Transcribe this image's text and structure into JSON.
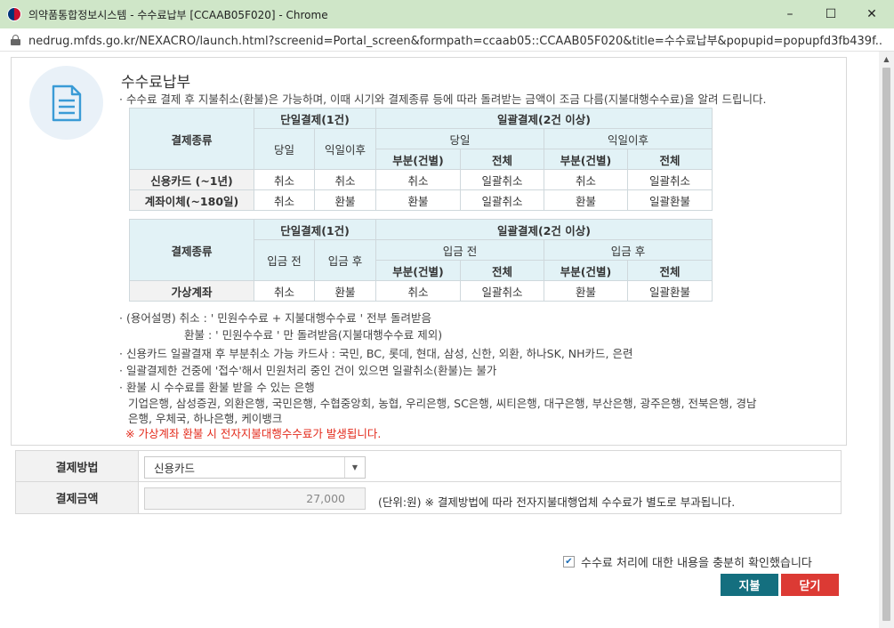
{
  "window": {
    "title": "의약품통합정보시스템 - 수수료납부 [CCAAB05F020] - Chrome",
    "url": "nedrug.mfds.go.kr/NEXACRO/launch.html?screenid=Portal_screen&formpath=ccaab05::CCAAB05F020&title=수수료납부&popupid=popupfd3fb439f..."
  },
  "header": {
    "title": "수수료납부",
    "desc": "· 수수료 결제 후 지불취소(환불)은 가능하며, 이때 시기와 결제종류 등에 따라 돌려받는 금액이 조금 다름(지불대행수수료)을 알려 드립니다."
  },
  "table1": {
    "corner": "결제종류",
    "single": "단일결제(1건)",
    "bulk": "일괄결제(2건 이상)",
    "single_a": "당일",
    "single_b": "익일이후",
    "bulk_a": "당일",
    "bulk_b": "익일이후",
    "partial": "부분(건별)",
    "whole": "전체",
    "rows": [
      {
        "label": "신용카드 (~1년)",
        "cells": [
          "취소",
          "취소",
          "취소",
          "일괄취소",
          "취소",
          "일괄취소"
        ]
      },
      {
        "label": "계좌이체(~180일)",
        "cells": [
          "취소",
          "환불",
          "환불",
          "일괄취소",
          "환불",
          "일괄환불"
        ]
      }
    ]
  },
  "table2": {
    "corner": "결제종류",
    "single": "단일결제(1건)",
    "bulk": "일괄결제(2건 이상)",
    "single_a": "입금 전",
    "single_b": "입금 후",
    "bulk_a": "입금 전",
    "bulk_b": "입금 후",
    "partial": "부분(건별)",
    "whole": "전체",
    "rows": [
      {
        "label": "가상계좌",
        "cells": [
          "취소",
          "환불",
          "취소",
          "일괄취소",
          "환불",
          "일괄환불"
        ]
      }
    ]
  },
  "notes": {
    "n1": "· (용어설명) 취소 : ' 민원수수료 + 지불대행수수료 ' 전부 돌려받음",
    "n1b": "환불 : ' 민원수수료 ' 만 돌려받음(지불대행수수료 제외)",
    "n2": "· 신용카드 일괄결재 후 부분취소 가능 카드사 : 국민, BC, 롯데, 현대, 삼성, 신한, 외환, 하나SK, NH카드, 은련",
    "n3": "· 일괄결제한 건중에 '접수'해서 민원처리 중인 건이 있으면 일괄취소(환불)는 불가",
    "n4": "· 환불 시 수수료를 환불 받을 수 있는 은행",
    "banks1": "기업은행, 삼성증권, 외환은행, 국민은행, 수협중앙회, 농협, 우리은행, SC은행, 씨티은행, 대구은행, 부산은행, 광주은행, 전북은행, 경남",
    "banks2": "은행, 우체국, 하나은행, 케이뱅크",
    "warning": "※ 가상계좌 환불 시 전자지불대행수수료가 발생됩니다."
  },
  "form": {
    "method_label": "결제방법",
    "method_value": "신용카드",
    "amount_label": "결제금액",
    "amount_value": "27,000",
    "unit_note": "(단위:원) ※ 결제방법에 따라 전자지불대행업체 수수료가 별도로 부과됩니다."
  },
  "confirm": {
    "label": "수수료 처리에 대한 내용을 충분히 확인했습니다",
    "checked": true
  },
  "buttons": {
    "pay": "지불",
    "close": "닫기"
  },
  "colors": {
    "pay": "#146f7f",
    "close": "#dc3a34",
    "header_bg": "#e2f2f6",
    "titlebar": "#cfe6c8",
    "warning": "#e32a1b"
  }
}
